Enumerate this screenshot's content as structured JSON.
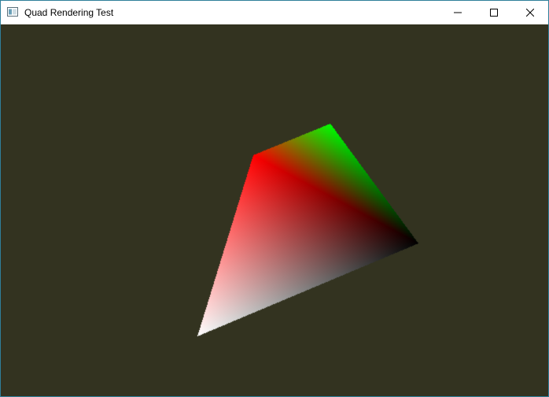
{
  "window": {
    "title": "Quad Rendering Test",
    "icon": "window-app-icon"
  },
  "controls": {
    "minimize_icon": "minimize-icon",
    "maximize_icon": "maximize-icon",
    "close_icon": "close-icon"
  },
  "viewport": {
    "clear_color": "#333320",
    "quad": {
      "vertex_colors": [
        "#ff0000",
        "#00ff00",
        "#000000",
        "#ffffff"
      ]
    }
  },
  "colors": {
    "window_border": "#2f7f9a",
    "titlebar_bg": "#ffffff",
    "close_hover": "#e81123"
  }
}
